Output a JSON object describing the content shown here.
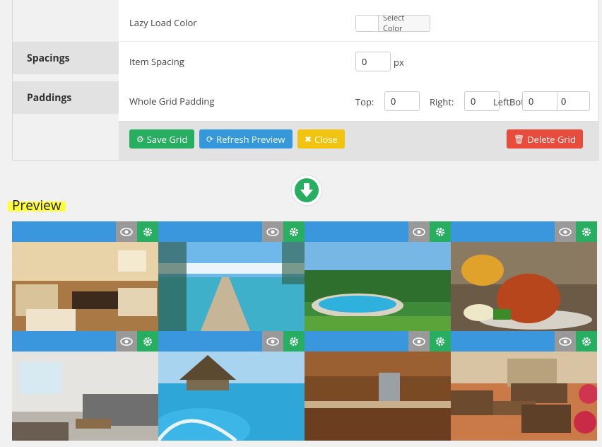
{
  "sidebar": {
    "tabs": [
      {
        "label": "Spacings"
      },
      {
        "label": "Paddings"
      }
    ]
  },
  "settings": {
    "lazy_load_color": {
      "label": "Lazy Load Color",
      "button": "Select Color"
    },
    "item_spacing": {
      "label": "Item Spacing",
      "value": "0",
      "unit": "px"
    },
    "grid_padding": {
      "label": "Whole Grid Padding",
      "top_label": "Top:",
      "top": "0",
      "right_label": "Right:",
      "right": "0",
      "bottom_label": "Bottom:",
      "bottom": "0",
      "left_label": "Left:",
      "left": "0"
    }
  },
  "actions": {
    "save": "Save Grid",
    "refresh": "Refresh Preview",
    "close": "Close",
    "delete": "Delete Grid"
  },
  "preview": {
    "title": "Preview"
  },
  "colors": {
    "green": "#27ae60",
    "blue": "#3498db",
    "yellow": "#f1c40f",
    "red": "#e74c3c",
    "item_bar": "#3a96dd"
  }
}
